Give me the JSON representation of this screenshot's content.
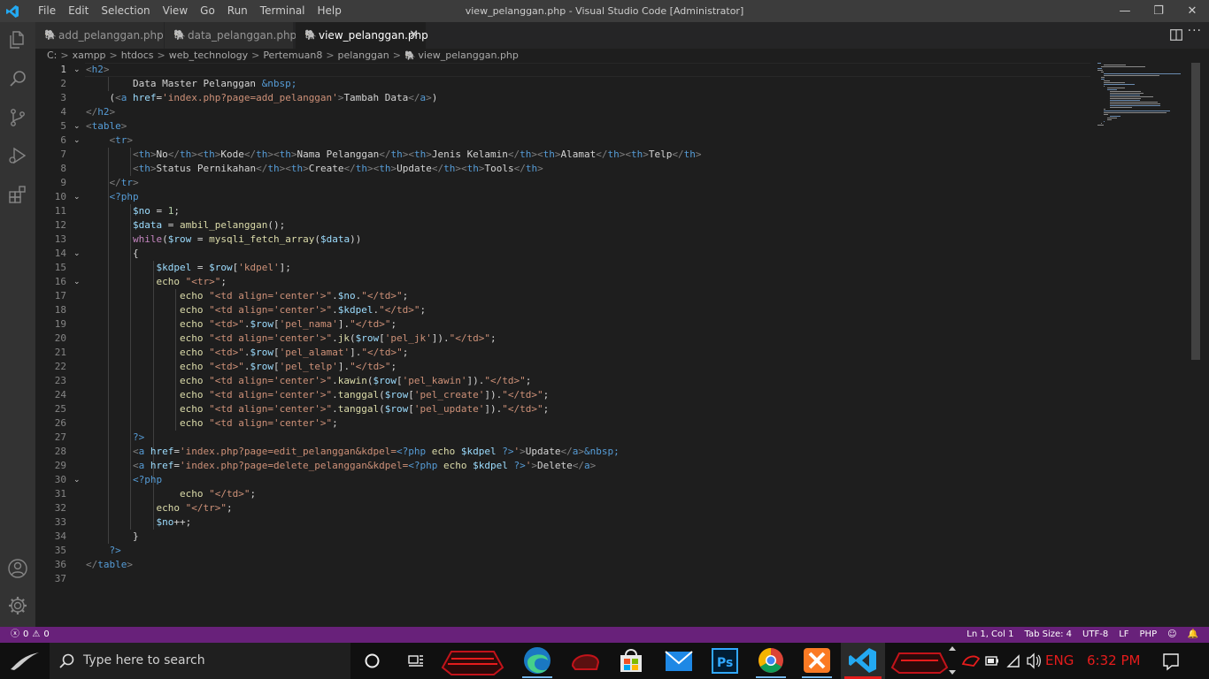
{
  "titlebar": {
    "menu": [
      "File",
      "Edit",
      "Selection",
      "View",
      "Go",
      "Run",
      "Terminal",
      "Help"
    ],
    "title": "view_pelanggan.php - Visual Studio Code [Administrator]",
    "minimize": "—",
    "maximize": "❐",
    "close": "✕"
  },
  "activity_icons": [
    "explorer-icon",
    "search-icon",
    "source-control-icon",
    "run-debug-icon",
    "extensions-icon",
    "account-icon",
    "settings-gear-icon"
  ],
  "tabs": [
    {
      "label": "add_pelanggan.php",
      "icon": "elephant-icon"
    },
    {
      "label": "data_pelanggan.php",
      "icon": "elephant-icon"
    },
    {
      "label": "view_pelanggan.php",
      "icon": "elephant-icon",
      "close": "✕"
    }
  ],
  "breadcrumb": [
    "C:",
    "xampp",
    "htdocs",
    "web_technology",
    "Pertemuan8",
    "pelanggan",
    "view_pelanggan.php"
  ],
  "editor": {
    "line_numbers": [
      "1",
      "2",
      "3",
      "4",
      "5",
      "6",
      "7",
      "8",
      "9",
      "10",
      "11",
      "12",
      "13",
      "14",
      "15",
      "16",
      "17",
      "18",
      "19",
      "20",
      "21",
      "22",
      "23",
      "24",
      "25",
      "26",
      "27",
      "28",
      "29",
      "30",
      "31",
      "32",
      "33",
      "34",
      "35",
      "36",
      "37"
    ],
    "folds": {
      "1": "⌄",
      "5": "⌄",
      "6": "⌄",
      "10": "⌄",
      "14": "⌄",
      "16": "⌄",
      "30": "⌄"
    }
  },
  "statusbar": {
    "errors": "0",
    "warnings": "0",
    "position": "Ln 1, Col 1",
    "tab_size": "Tab Size: 4",
    "encoding": "UTF-8",
    "eol": "LF",
    "language": "PHP"
  },
  "taskbar": {
    "search_placeholder": "Type here to search",
    "lang": "ENG",
    "time": "6:32 PM"
  },
  "colors": {
    "statusbar": "#68217a",
    "titlebar": "#3c3c3c",
    "activitybar": "#333333",
    "editor_bg": "#1e1e1e"
  }
}
